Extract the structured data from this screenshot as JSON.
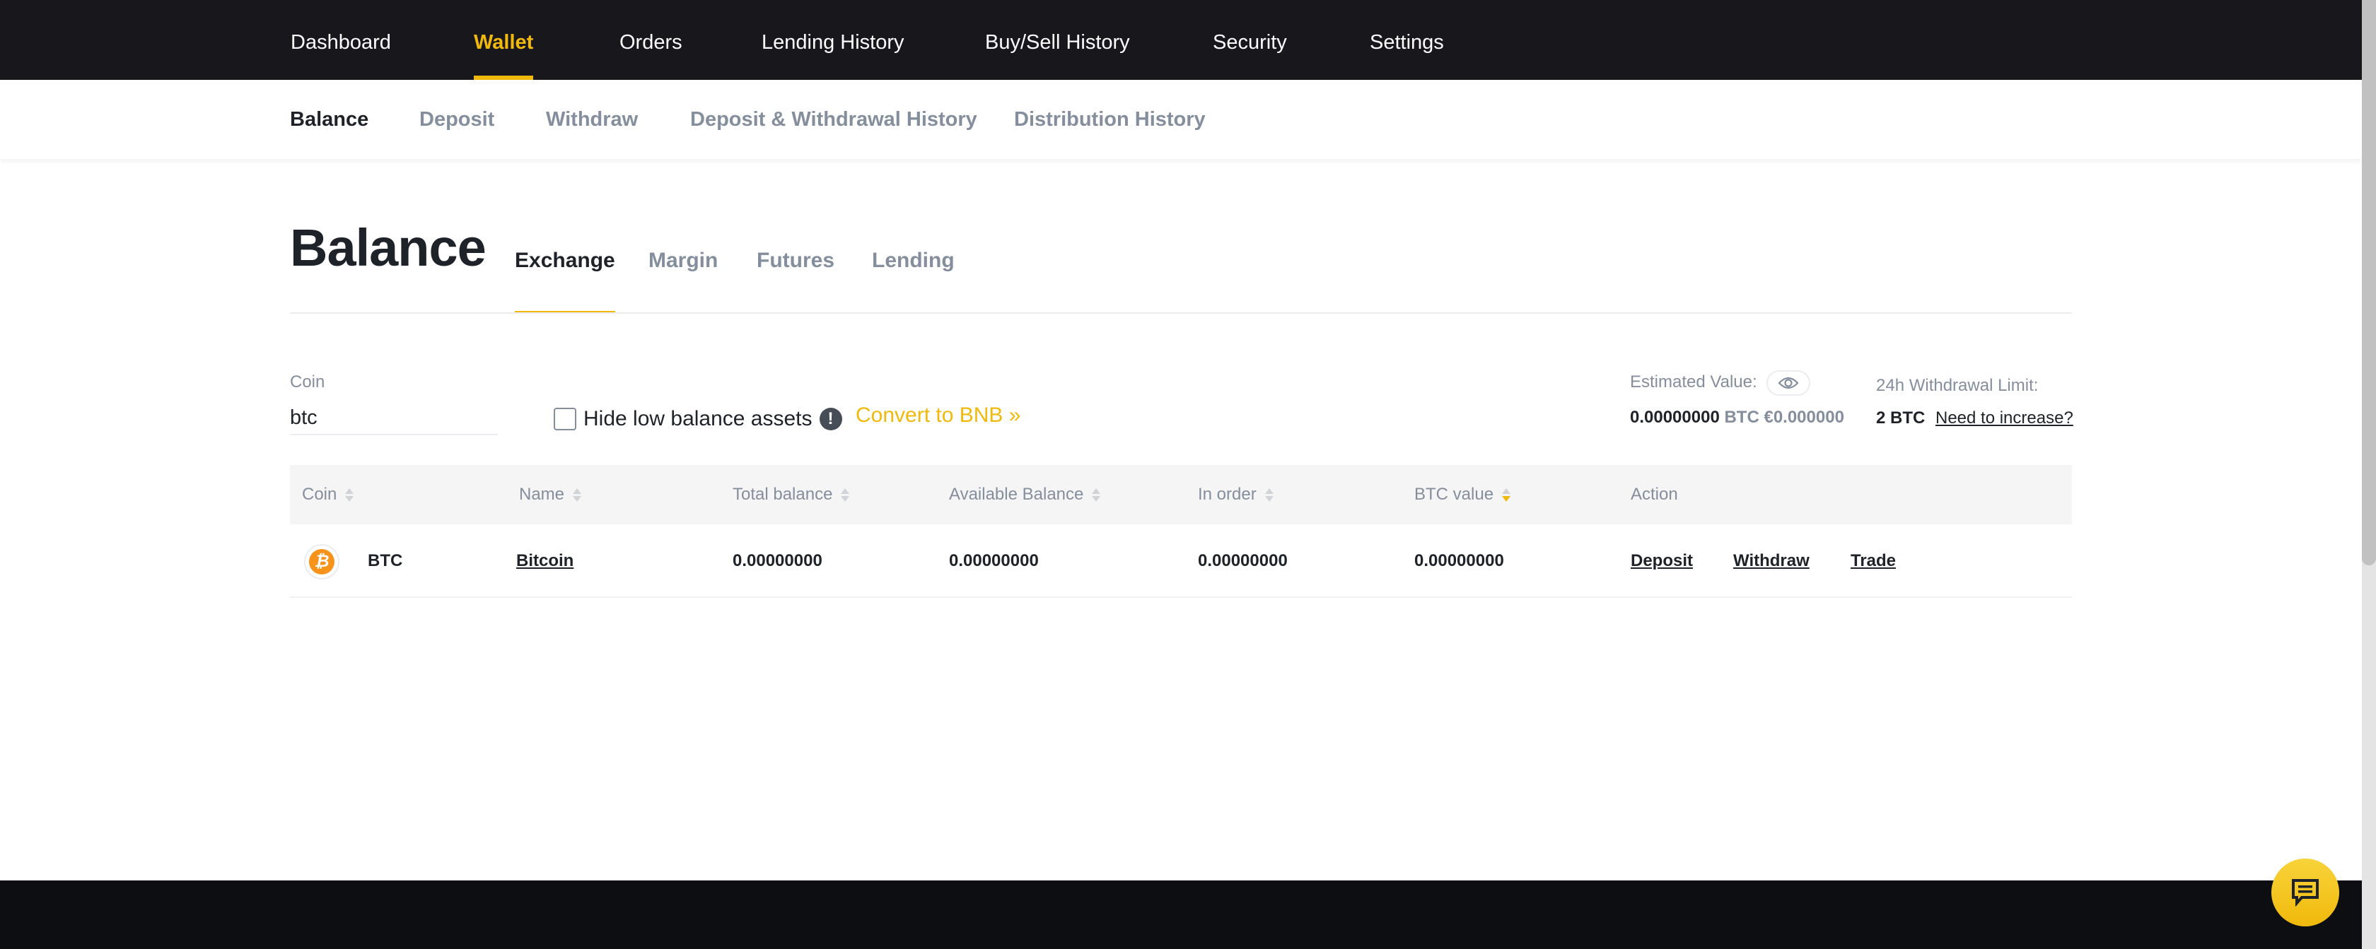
{
  "topnav": {
    "items": [
      {
        "label": "Dashboard",
        "active": false
      },
      {
        "label": "Wallet",
        "active": true
      },
      {
        "label": "Orders",
        "active": false
      },
      {
        "label": "Lending History",
        "active": false
      },
      {
        "label": "Buy/Sell History",
        "active": false
      },
      {
        "label": "Security",
        "active": false
      },
      {
        "label": "Settings",
        "active": false
      }
    ]
  },
  "subnav": {
    "items": [
      {
        "label": "Balance",
        "active": true
      },
      {
        "label": "Deposit",
        "active": false
      },
      {
        "label": "Withdraw",
        "active": false
      },
      {
        "label": "Deposit & Withdrawal History",
        "active": false
      },
      {
        "label": "Distribution History",
        "active": false
      }
    ]
  },
  "page": {
    "title": "Balance",
    "tabs": [
      {
        "label": "Exchange",
        "active": true
      },
      {
        "label": "Margin",
        "active": false
      },
      {
        "label": "Futures",
        "active": false
      },
      {
        "label": "Lending",
        "active": false
      }
    ]
  },
  "filters": {
    "coin_label": "Coin",
    "coin_value": "btc",
    "hide_low_balance_label": "Hide low balance assets",
    "hide_low_balance_checked": false,
    "info_icon": "!",
    "convert_link": "Convert to BNB »"
  },
  "summary": {
    "estimated_label": "Estimated Value:",
    "estimated_btc": "0.00000000",
    "estimated_btc_unit": "BTC",
    "estimated_fiat": "€0.000000",
    "withdrawal_limit_label": "24h Withdrawal Limit:",
    "withdrawal_limit_value": "2",
    "withdrawal_limit_unit": "BTC",
    "increase_link": "Need to increase?"
  },
  "table": {
    "columns": [
      {
        "label": "Coin",
        "sortable": true
      },
      {
        "label": "Name",
        "sortable": true
      },
      {
        "label": "Total balance",
        "sortable": true
      },
      {
        "label": "Available Balance",
        "sortable": true
      },
      {
        "label": "In order",
        "sortable": true
      },
      {
        "label": "BTC value",
        "sortable": true,
        "sorted": "desc"
      },
      {
        "label": "Action",
        "sortable": false
      }
    ],
    "rows": [
      {
        "coin_icon": "bitcoin-icon",
        "coin_glyph": "₿",
        "coin": "BTC",
        "name": "Bitcoin",
        "total_balance": "0.00000000",
        "available_balance": "0.00000000",
        "in_order": "0.00000000",
        "btc_value": "0.00000000",
        "actions": [
          "Deposit",
          "Withdraw",
          "Trade"
        ]
      }
    ]
  },
  "colors": {
    "accent": "#f0b90b",
    "nav_bg": "#18181c",
    "footer_bg": "#0c0e12",
    "text_primary": "#1e2329",
    "text_muted": "#848e9c",
    "bitcoin": "#f7931a"
  }
}
